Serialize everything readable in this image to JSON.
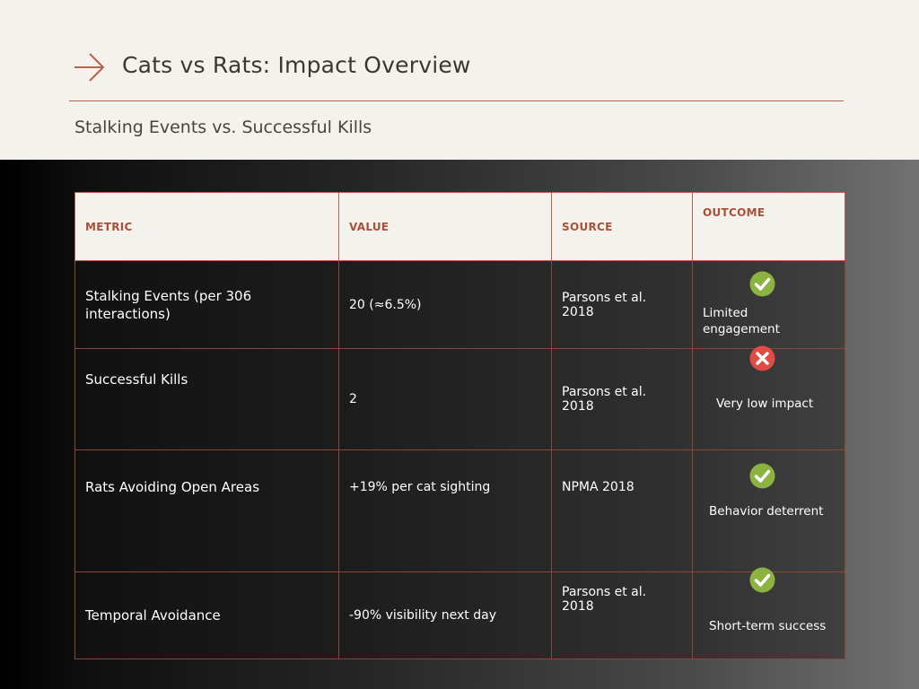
{
  "header": {
    "title": "Cats vs Rats: Impact Overview",
    "subtitle": "Stalking Events vs. Successful Kills",
    "accent_color": "#b9614a"
  },
  "table": {
    "columns": [
      "METRIC",
      "VALUE",
      "SOURCE",
      "OUTCOME"
    ],
    "rows": [
      {
        "metric": "Stalking Events (per 306 interactions)",
        "value": "20 (≈6.5%)",
        "source": "Parsons et al. 2018",
        "outcome_icon": "check-icon",
        "outcome": "Limited engagement"
      },
      {
        "metric": "Successful Kills",
        "value": "2",
        "source": "Parsons et al. 2018",
        "outcome_icon": "cross-icon",
        "outcome": "Very low impact"
      },
      {
        "metric": "Rats Avoiding Open Areas",
        "value": "+19% per cat sighting",
        "source": "NPMA 2018",
        "outcome_icon": "check-icon",
        "outcome": "Behavior deterrent"
      },
      {
        "metric": "Temporal Avoidance",
        "value": "-90% visibility next day",
        "source": "Parsons et al. 2018",
        "outcome_icon": "check-icon",
        "outcome": "Short-term success"
      }
    ]
  },
  "colors": {
    "check": "#8cb340",
    "cross": "#e04b44",
    "header_text": "#a9503a",
    "border": "#8a4636"
  }
}
